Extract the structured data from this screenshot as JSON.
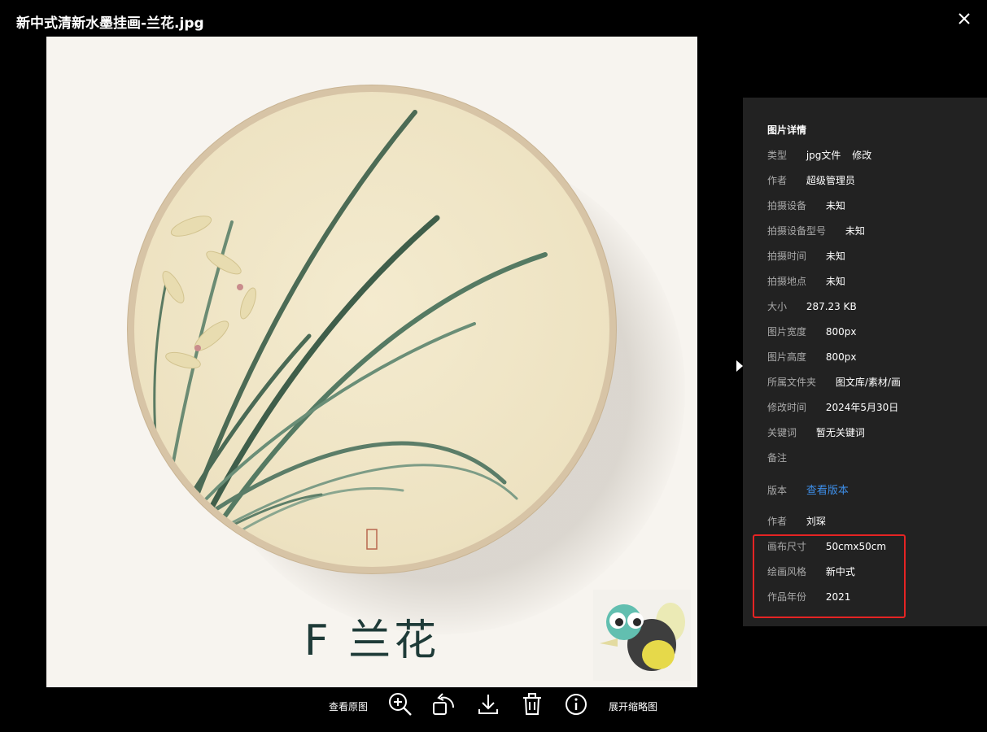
{
  "header": {
    "title": "新中式清新水墨挂画-兰花.jpg",
    "close_icon": "close-icon"
  },
  "image": {
    "caption": "F 兰花",
    "subject": "orchid-ink-painting"
  },
  "toolbar": {
    "view_original": "查看原图",
    "zoom_icon": "zoom-in-icon",
    "rotate_icon": "rotate-icon",
    "download_icon": "download-icon",
    "delete_icon": "delete-icon",
    "info_icon": "info-icon",
    "expand_thumbnails": "展开缩略图"
  },
  "panel": {
    "title": "图片详情",
    "type": {
      "label": "类型",
      "value": "jpg文件",
      "action": "修改"
    },
    "author": {
      "label": "作者",
      "value": "超级管理员"
    },
    "device": {
      "label": "拍摄设备",
      "value": "未知"
    },
    "device_model": {
      "label": "拍摄设备型号",
      "value": "未知"
    },
    "shot_time": {
      "label": "拍摄时间",
      "value": "未知"
    },
    "shot_place": {
      "label": "拍摄地点",
      "value": "未知"
    },
    "size": {
      "label": "大小",
      "value": "287.23 KB"
    },
    "width": {
      "label": "图片宽度",
      "value": "800px"
    },
    "height": {
      "label": "图片高度",
      "value": "800px"
    },
    "folder": {
      "label": "所属文件夹",
      "value": "图文库/素材/画"
    },
    "modified": {
      "label": "修改时间",
      "value": "2024年5月30日"
    },
    "keywords": {
      "label": "关键词",
      "value": "暂无关键词"
    },
    "remark": {
      "label": "备注",
      "value": ""
    },
    "version": {
      "label": "版本",
      "link": "查看版本"
    },
    "artist": {
      "label": "作者",
      "value": "刘琛"
    },
    "canvas_size": {
      "label": "画布尺寸",
      "value": "50cmx50cm"
    },
    "style": {
      "label": "绘画风格",
      "value": "新中式"
    },
    "year": {
      "label": "作品年份",
      "value": "2021"
    }
  },
  "colors": {
    "link": "#3d8ee8",
    "highlight_border": "#e52424",
    "panel_bg": "#222222"
  }
}
